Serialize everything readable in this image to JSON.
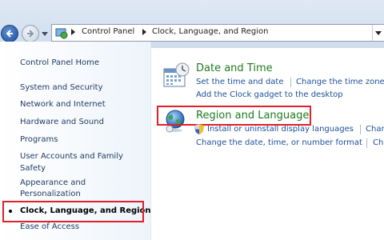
{
  "address_bar": {
    "segments": [
      "Control Panel",
      "Clock, Language, and Region"
    ]
  },
  "left_nav": {
    "items": [
      {
        "label": "Control Panel Home"
      },
      {
        "label": "System and Security"
      },
      {
        "label": "Network and Internet"
      },
      {
        "label": "Hardware and Sound"
      },
      {
        "label": "Programs"
      },
      {
        "label": "User Accounts and Family",
        "label2": "Safety"
      },
      {
        "label": "Appearance and",
        "label2": "Personalization"
      },
      {
        "label": "Clock, Language, and Region"
      },
      {
        "label": "Ease of Access"
      }
    ]
  },
  "categories": {
    "date_time": {
      "title": "Date and Time",
      "links": [
        "Set the time and date",
        "Change the time zone",
        "Add the Clock gadget to the desktop"
      ]
    },
    "region_language": {
      "title": "Region and Language",
      "links": [
        "Install or uninstall display languages",
        "Char",
        "Change the date, time, or number format",
        "Ch"
      ]
    }
  },
  "colors": {
    "category_title": "#1e7a1e",
    "link": "#1d4f98",
    "highlight_box": "#e0202a"
  },
  "icons": [
    "back-arrow-icon",
    "forward-arrow-icon",
    "control-panel-icon",
    "calendar-clock-icon",
    "globe-icon",
    "shield-icon"
  ]
}
